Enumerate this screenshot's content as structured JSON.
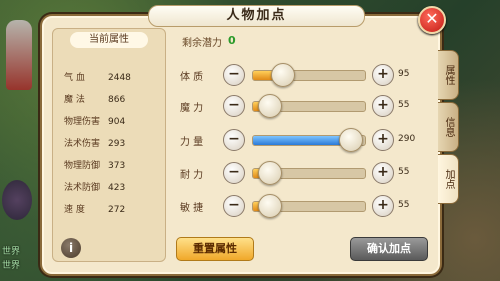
{
  "background_text": [
    "世界",
    "世界"
  ],
  "window": {
    "title": "人物加点",
    "close": "✕"
  },
  "left_panel": {
    "header": "当前属性",
    "stats": [
      {
        "label": "气    血",
        "value": "2448"
      },
      {
        "label": "魔    法",
        "value": "866"
      },
      {
        "label": "物理伤害",
        "value": "904"
      },
      {
        "label": "法术伤害",
        "value": "293"
      },
      {
        "label": "物理防御",
        "value": "373"
      },
      {
        "label": "法术防御",
        "value": "423"
      },
      {
        "label": "速    度",
        "value": "272"
      }
    ],
    "info_icon": "i"
  },
  "potential": {
    "label": "剩余潜力",
    "value": "0"
  },
  "attributes": [
    {
      "label": "体  质",
      "value": "95",
      "fill_pct": 22,
      "color": "#e08a18"
    },
    {
      "label": "魔  力",
      "value": "55",
      "fill_pct": 10,
      "color": "#e08a18"
    },
    {
      "label": "力  量",
      "value": "290",
      "fill_pct": 88,
      "color": "#2a7ad8"
    },
    {
      "label": "耐  力",
      "value": "55",
      "fill_pct": 10,
      "color": "#e08a18"
    },
    {
      "label": "敏  捷",
      "value": "55",
      "fill_pct": 10,
      "color": "#e08a18"
    }
  ],
  "buttons": {
    "reset": "重置属性",
    "confirm": "确认加点",
    "minus": "−",
    "plus": "+"
  },
  "tabs": [
    {
      "label": "属性",
      "active": false
    },
    {
      "label": "信息",
      "active": false
    },
    {
      "label": "加点",
      "active": true
    }
  ]
}
